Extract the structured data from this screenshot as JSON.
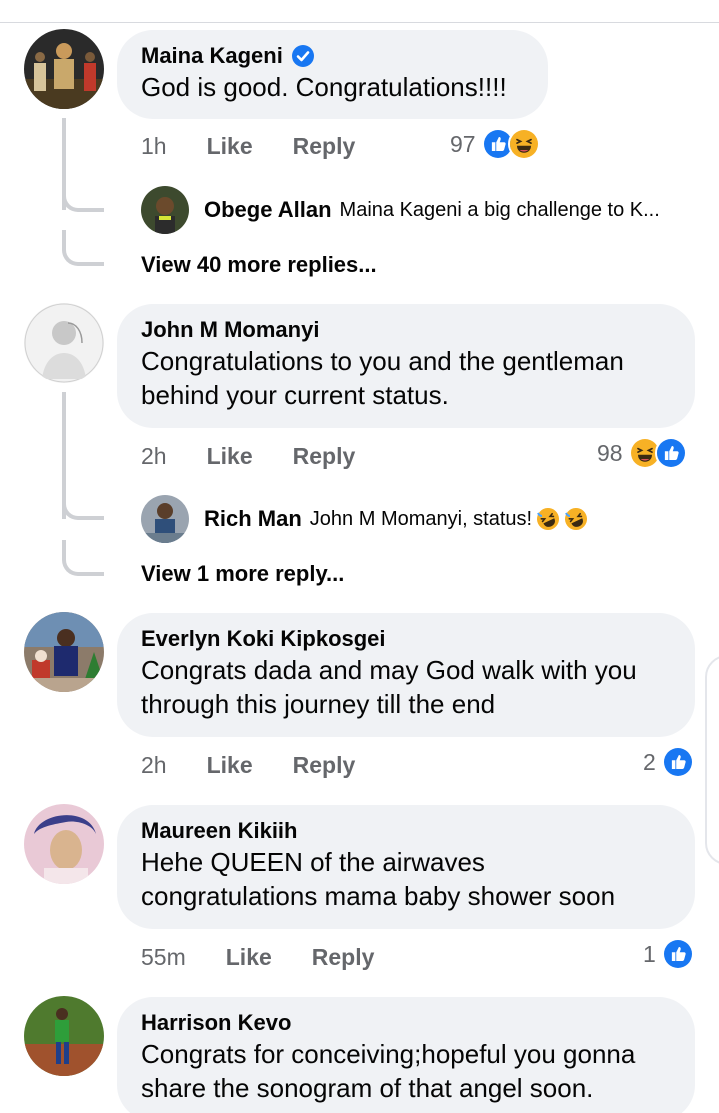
{
  "comments": [
    {
      "author": "Maina Kageni",
      "verified": true,
      "text_lines": [
        "God is good. Congratulations!!!!"
      ],
      "time": "1h",
      "like_label": "Like",
      "reply_label": "Reply",
      "reaction_count": "97",
      "reactions": [
        "like-icon",
        "haha-icon"
      ],
      "reply_preview": {
        "author": "Obege Allan",
        "text": "Maina Kageni a big challenge to K..."
      },
      "more_replies": "View 40 more replies..."
    },
    {
      "author": "John M Momanyi",
      "verified": false,
      "text_lines": [
        "Congratulations to you and the gentleman",
        "behind your current status."
      ],
      "time": "2h",
      "like_label": "Like",
      "reply_label": "Reply",
      "reaction_count": "98",
      "reactions": [
        "haha-icon",
        "like-icon"
      ],
      "reply_preview": {
        "author": "Rich Man",
        "text": "John M Momanyi, status!"
      },
      "more_replies": "View 1 more reply..."
    },
    {
      "author": "Everlyn Koki Kipkosgei",
      "verified": false,
      "text_lines": [
        "Congrats dada and may God walk with you",
        "through this journey till the end"
      ],
      "time": "2h",
      "like_label": "Like",
      "reply_label": "Reply",
      "reaction_count": "2",
      "reactions": [
        "like-icon"
      ]
    },
    {
      "author": "Maureen Kikiih",
      "verified": false,
      "text_lines": [
        "Hehe QUEEN of the airwaves",
        "congratulations mama baby shower soon"
      ],
      "time": "55m",
      "like_label": "Like",
      "reply_label": "Reply",
      "reaction_count": "1",
      "reactions": [
        "like-icon"
      ]
    },
    {
      "author": "Harrison Kevo",
      "verified": false,
      "text_lines": [
        "Congrats for conceiving;hopeful you gonna",
        "share the sonogram of that angel soon."
      ]
    }
  ],
  "colors": {
    "bubble": "#f0f2f5",
    "meta_text": "#65676b",
    "like_blue": "#1877f2",
    "haha_yellow": "#f7b125",
    "thread_line": "#ced0d4"
  }
}
